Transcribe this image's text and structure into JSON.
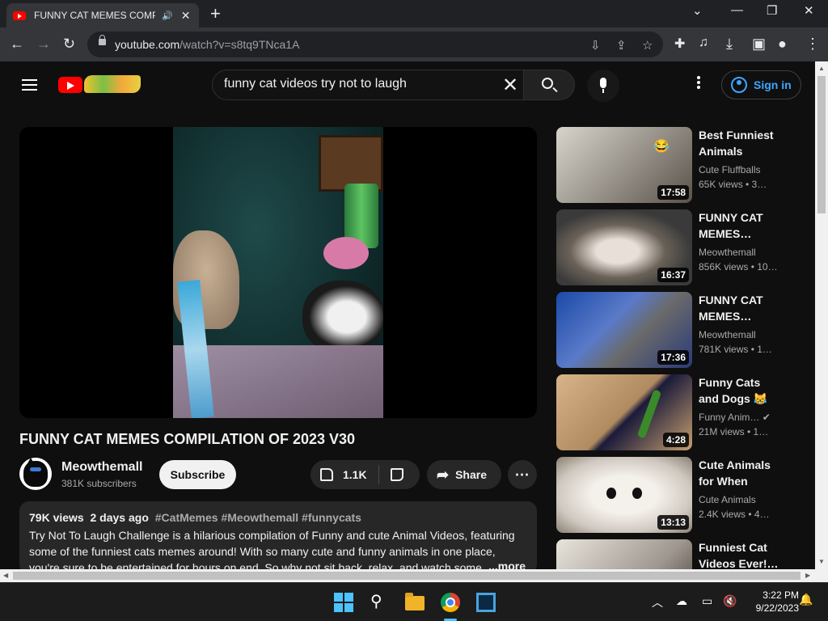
{
  "browser": {
    "tab_title": "FUNNY CAT MEMES COMPILATI",
    "url_host": "youtube.com",
    "url_path": "/watch?v=s8tq9TNca1A"
  },
  "youtube": {
    "search_query": "funny cat videos try not to laugh",
    "sign_in": "Sign in"
  },
  "video": {
    "title": "FUNNY CAT MEMES COMPILATION OF 2023 V30",
    "channel": "Meowthemall",
    "subscribers": "381K subscribers",
    "subscribe_label": "Subscribe",
    "likes": "1.1K",
    "share_label": "Share",
    "views": "79K views",
    "age": "2 days ago",
    "tags": "#CatMemes #Meowthemall #funnycats",
    "description": "Try Not To Laugh Challenge is a hilarious compilation of Funny and cute Animal Videos, featuring some of the funniest cats memes around! With so many cute and funny animals in one place, you're sure to be entertained for hours on end. So why not sit back, relax, and watch some c",
    "more_label": "...more"
  },
  "related": [
    {
      "title": "Best Funniest Animals video…",
      "channel": "Cute Fluffballs",
      "meta": "65K views • 3…",
      "duration": "17:58"
    },
    {
      "title": "FUNNY CAT MEMES…",
      "channel": "Meowthemall",
      "meta": "856K views • 10…",
      "duration": "16:37"
    },
    {
      "title": "FUNNY CAT MEMES…",
      "channel": "Meowthemall",
      "meta": "781K views • 1…",
      "duration": "17:36"
    },
    {
      "title": "Funny Cats and Dogs 😹 🙀 |…",
      "channel": "Funny Anim…",
      "meta": "21M views • 1…",
      "duration": "4:28"
    },
    {
      "title": "Cute Animals for When You…",
      "channel": "Cute Animals",
      "meta": "2.4K views • 4…",
      "duration": "13:13"
    },
    {
      "title": "Funniest Cat Videos Ever!…",
      "channel": "",
      "meta": "",
      "duration": ""
    }
  ],
  "taskbar": {
    "time": "3:22 PM",
    "date": "9/22/2023"
  }
}
